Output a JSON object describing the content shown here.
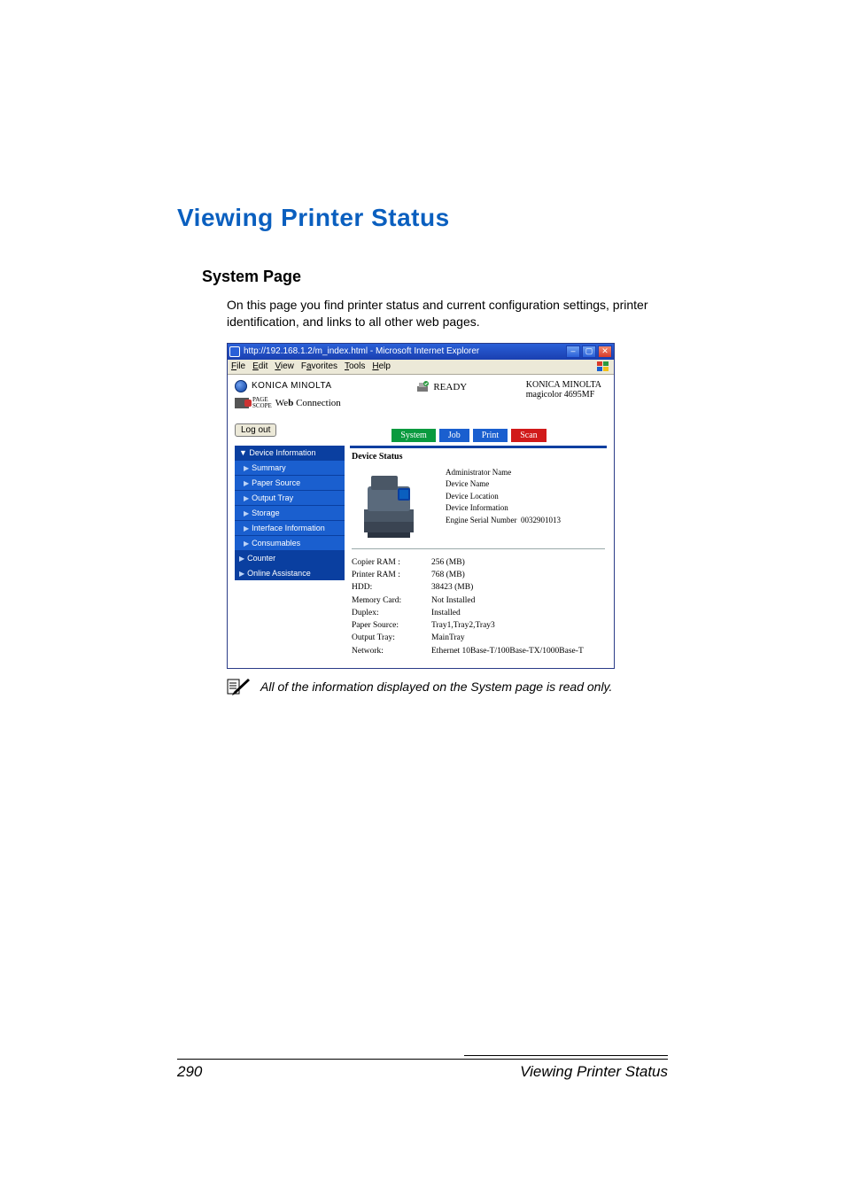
{
  "heading": "Viewing Printer Status",
  "subheading": "System Page",
  "body": "On this page you find printer status and current configuration settings, printer identification, and links to all other web pages.",
  "note": "All of the information displayed on the System page is read only.",
  "footer": {
    "page": "290",
    "title": "Viewing Printer Status"
  },
  "window": {
    "title": "http://192.168.1.2/m_index.html - Microsoft Internet Explorer",
    "menus": [
      "File",
      "Edit",
      "View",
      "Favorites",
      "Tools",
      "Help"
    ]
  },
  "brand": {
    "name": "KONICA MINOLTA",
    "pagescope1": "PAGE",
    "pagescope2": "SCOPE",
    "webconn": "Web Connection"
  },
  "status": {
    "ready": "READY"
  },
  "model": {
    "vendor": "KONICA MINOLTA",
    "name": "magicolor 4695MF"
  },
  "logout": "Log out",
  "tabs": [
    "System",
    "Job",
    "Print",
    "Scan"
  ],
  "sidebar": {
    "head": "Device Information",
    "items": [
      "Summary",
      "Paper Source",
      "Output Tray",
      "Storage",
      "Interface Information",
      "Consumables"
    ],
    "counter": "Counter",
    "online": "Online Assistance"
  },
  "panel": {
    "title": "Device Status",
    "info": {
      "admin": "Administrator Name",
      "dname": "Device Name",
      "dloc": "Device Location",
      "dinfo": "Device Information",
      "serial_label": "Engine Serial Number",
      "serial_value": "0032901013"
    },
    "specs": {
      "labels": {
        "copier_ram": "Copier RAM :",
        "printer_ram": "Printer RAM :",
        "hdd": "HDD:",
        "memcard": "Memory Card:",
        "duplex": "Duplex:",
        "psource": "Paper Source:",
        "otray": "Output Tray:",
        "network": "Network:"
      },
      "values": {
        "copier_ram": "256 (MB)",
        "printer_ram": "768 (MB)",
        "hdd": "38423 (MB)",
        "memcard": "Not Installed",
        "duplex": "Installed",
        "psource": "Tray1,Tray2,Tray3",
        "otray": "MainTray",
        "network": "Ethernet 10Base-T/100Base-TX/1000Base-T"
      }
    }
  }
}
